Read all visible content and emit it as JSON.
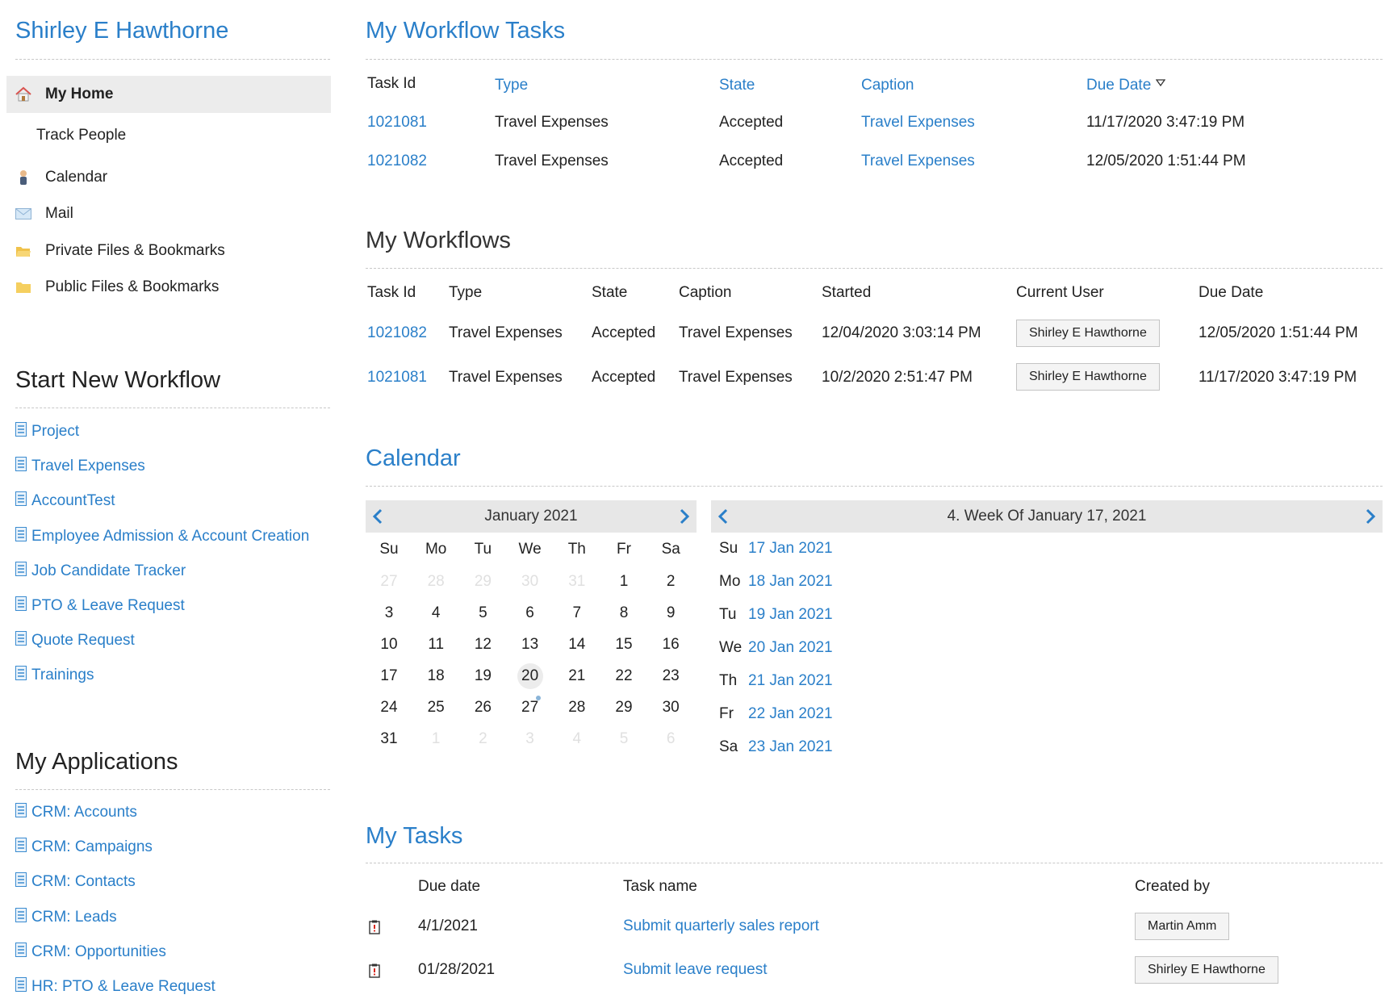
{
  "sidebar": {
    "user_name": "Shirley E Hawthorne",
    "nav": [
      {
        "label": "My Home",
        "icon": "home-icon",
        "active": true
      },
      {
        "label": "Track People",
        "icon": "",
        "active": false
      },
      {
        "label": "Calendar",
        "icon": "person-icon",
        "active": false
      },
      {
        "label": "Mail",
        "icon": "mail-icon",
        "active": false
      },
      {
        "label": "Private Files & Bookmarks",
        "icon": "folder-open-icon",
        "active": false
      },
      {
        "label": "Public Files & Bookmarks",
        "icon": "folder-icon",
        "active": false
      }
    ],
    "start_workflow": {
      "title": "Start New Workflow",
      "items": [
        "Project",
        "Travel Expenses",
        "AccountTest",
        "Employee Admission & Account Creation",
        "Job Candidate Tracker",
        "PTO & Leave Request",
        "Quote Request",
        "Trainings"
      ]
    },
    "applications": {
      "title": "My Applications",
      "items": [
        "CRM: Accounts",
        "CRM: Campaigns",
        "CRM: Contacts",
        "CRM: Leads",
        "CRM: Opportunities",
        "HR: PTO & Leave Request"
      ]
    }
  },
  "workflow_tasks": {
    "title": "My Workflow Tasks",
    "headers": {
      "task_id": "Task Id",
      "type": "Type",
      "state": "State",
      "caption": "Caption",
      "due_date": "Due Date"
    },
    "rows": [
      {
        "task_id": "1021081",
        "type": "Travel Expenses",
        "state": "Accepted",
        "caption": "Travel Expenses",
        "due_date": "11/17/2020 3:47:19 PM"
      },
      {
        "task_id": "1021082",
        "type": "Travel Expenses",
        "state": "Accepted",
        "caption": "Travel Expenses",
        "due_date": "12/05/2020 1:51:44 PM"
      }
    ]
  },
  "workflows": {
    "title": "My Workflows",
    "headers": {
      "task_id": "Task Id",
      "type": "Type",
      "state": "State",
      "caption": "Caption",
      "started": "Started",
      "current_user": "Current User",
      "due_date": "Due Date"
    },
    "rows": [
      {
        "task_id": "1021082",
        "type": "Travel Expenses",
        "state": "Accepted",
        "caption": "Travel Expenses",
        "started": "12/04/2020 3:03:14 PM",
        "current_user": "Shirley E Hawthorne",
        "due_date": "12/05/2020 1:51:44 PM"
      },
      {
        "task_id": "1021081",
        "type": "Travel Expenses",
        "state": "Accepted",
        "caption": "Travel Expenses",
        "started": "10/2/2020 2:51:47 PM",
        "current_user": "Shirley E Hawthorne",
        "due_date": "11/17/2020 3:47:19 PM"
      }
    ]
  },
  "calendar": {
    "title": "Calendar",
    "month_title": "January 2021",
    "dow": [
      "Su",
      "Mo",
      "Tu",
      "We",
      "Th",
      "Fr",
      "Sa"
    ],
    "weeks": [
      [
        "27",
        "28",
        "29",
        "30",
        "31",
        "1",
        "2"
      ],
      [
        "3",
        "4",
        "5",
        "6",
        "7",
        "8",
        "9"
      ],
      [
        "10",
        "11",
        "12",
        "13",
        "14",
        "15",
        "16"
      ],
      [
        "17",
        "18",
        "19",
        "20",
        "21",
        "22",
        "23"
      ],
      [
        "24",
        "25",
        "26",
        "27",
        "28",
        "29",
        "30"
      ],
      [
        "31",
        "1",
        "2",
        "3",
        "4",
        "5",
        "6"
      ]
    ],
    "muted": [
      [
        0,
        0
      ],
      [
        0,
        1
      ],
      [
        0,
        2
      ],
      [
        0,
        3
      ],
      [
        0,
        4
      ],
      [
        5,
        1
      ],
      [
        5,
        2
      ],
      [
        5,
        3
      ],
      [
        5,
        4
      ],
      [
        5,
        5
      ],
      [
        5,
        6
      ]
    ],
    "today": [
      3,
      3
    ],
    "event_marker": [
      4,
      3
    ],
    "week_title": "4. Week Of January 17, 2021",
    "week_days": [
      {
        "dow": "Su",
        "date": "17 Jan 2021"
      },
      {
        "dow": "Mo",
        "date": "18 Jan 2021"
      },
      {
        "dow": "Tu",
        "date": "19 Jan 2021"
      },
      {
        "dow": "We",
        "date": "20 Jan 2021"
      },
      {
        "dow": "Th",
        "date": "21 Jan 2021"
      },
      {
        "dow": "Fr",
        "date": "22 Jan 2021"
      },
      {
        "dow": "Sa",
        "date": "23 Jan 2021"
      }
    ]
  },
  "tasks": {
    "title": "My Tasks",
    "headers": {
      "due_date": "Due date",
      "task_name": "Task name",
      "created_by": "Created by"
    },
    "rows": [
      {
        "due_date": "4/1/2021",
        "task_name": "Submit quarterly sales report",
        "created_by": "Martin Amm"
      },
      {
        "due_date": "01/28/2021",
        "task_name": "Submit leave request",
        "created_by": "Shirley E Hawthorne"
      }
    ]
  },
  "colors": {
    "accent": "#2a7fc9",
    "active_bg": "#ececec",
    "bar_bg": "#e7e7e7"
  }
}
